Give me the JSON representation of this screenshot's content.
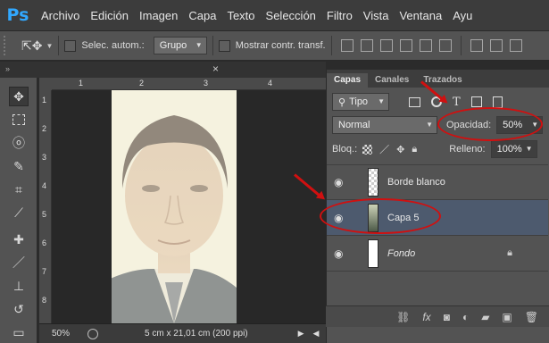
{
  "app": {
    "logo": "Ps"
  },
  "menu": [
    "Archivo",
    "Edición",
    "Imagen",
    "Capa",
    "Texto",
    "Selección",
    "Filtro",
    "Vista",
    "Ventana",
    "Ayu"
  ],
  "options": {
    "auto_select_label": "Selec. autom.:",
    "auto_select_value": "Grupo",
    "transform_label": "Mostrar contr. transf."
  },
  "document": {
    "ruler_h": [
      "1",
      "2",
      "3",
      "4"
    ],
    "ruler_v": [
      "1",
      "2",
      "3",
      "4",
      "5",
      "6",
      "7",
      "8"
    ],
    "zoom": "50%",
    "info": "5 cm x 21,01 cm (200 ppi)"
  },
  "tools": [
    "move-tool",
    "marquee-tool",
    "lasso-tool",
    "quick-select-tool",
    "crop-tool",
    "eyedropper-tool",
    "healing-brush-tool",
    "brush-tool",
    "clone-stamp-tool",
    "history-brush-tool",
    "eraser-tool"
  ],
  "layers_panel": {
    "tabs": [
      "Capas",
      "Canales",
      "Trazados"
    ],
    "filter_label": "Tipo",
    "blend_mode": "Normal",
    "opacity_label": "Opacidad:",
    "opacity_value": "50%",
    "lock_label": "Bloq.:",
    "fill_label": "Relleno:",
    "fill_value": "100%",
    "layers": [
      {
        "name": "Borde blanco",
        "selected": false,
        "italic": false
      },
      {
        "name": "Capa 5",
        "selected": true,
        "italic": false
      },
      {
        "name": "Fondo",
        "selected": false,
        "italic": true,
        "locked": true
      }
    ]
  },
  "colors": {
    "annotation": "#d01010",
    "selected_layer": "#4d5a6e",
    "ps_blue": "#31a8ff"
  }
}
